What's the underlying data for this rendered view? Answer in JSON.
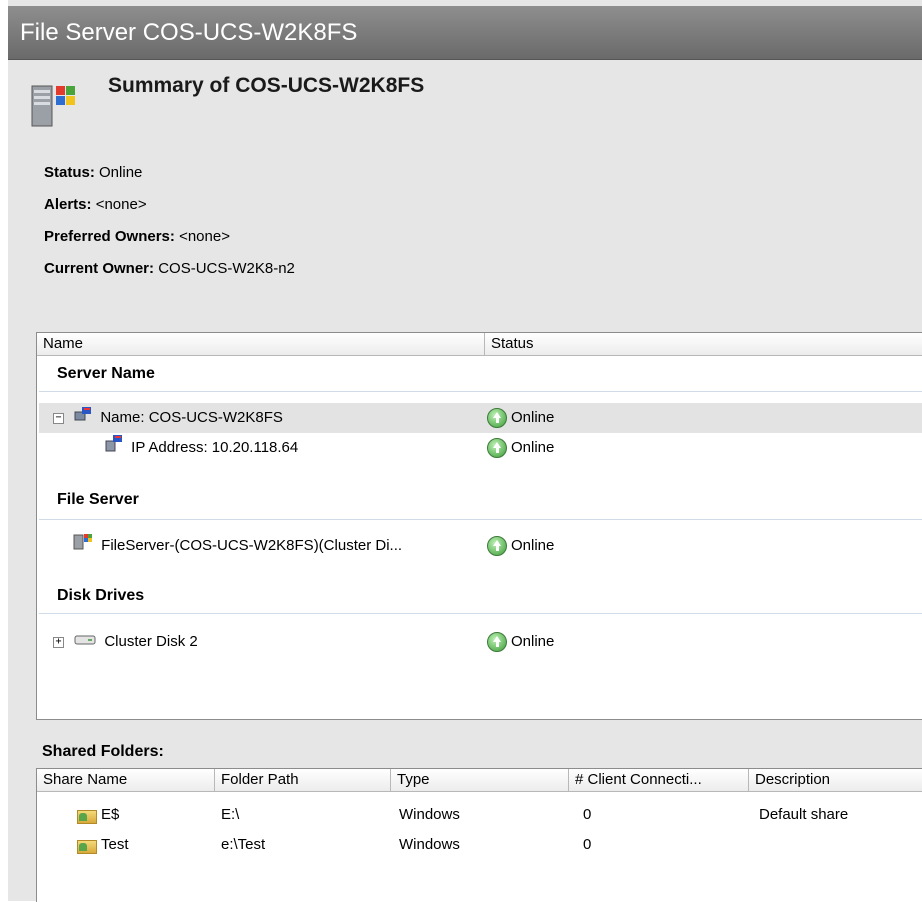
{
  "window": {
    "title": "File Server COS-UCS-W2K8FS"
  },
  "summary": {
    "title": "Summary of COS-UCS-W2K8FS",
    "properties": [
      {
        "label": "Status:",
        "value": "Online"
      },
      {
        "label": "Alerts:",
        "value": "<none>"
      },
      {
        "label": "Preferred Owners:",
        "value": "<none>"
      },
      {
        "label": "Current Owner:",
        "value": "COS-UCS-W2K8-n2"
      }
    ]
  },
  "resources": {
    "columns": [
      "Name",
      "Status"
    ],
    "groups": [
      {
        "title": "Server Name",
        "items": [
          {
            "expander": "−",
            "name": "Name: COS-UCS-W2K8FS",
            "status": "Online"
          },
          {
            "name": "IP Address: 10.20.118.64",
            "status": "Online"
          }
        ]
      },
      {
        "title": "File Server",
        "items": [
          {
            "name": "FileServer-(COS-UCS-W2K8FS)(Cluster Di...",
            "status": "Online"
          }
        ]
      },
      {
        "title": "Disk Drives",
        "items": [
          {
            "expander": "+",
            "name": "Cluster Disk 2",
            "status": "Online"
          }
        ]
      }
    ]
  },
  "shared_folders": {
    "label": "Shared Folders:",
    "columns": [
      "Share Name",
      "Folder Path",
      "Type",
      "# Client Connecti...",
      "Description"
    ],
    "rows": [
      {
        "share": "E$",
        "path": "E:\\",
        "type": "Windows",
        "connections": "0",
        "description": "Default share"
      },
      {
        "share": "Test",
        "path": "e:\\Test",
        "type": "Windows",
        "connections": "0",
        "description": ""
      }
    ]
  }
}
